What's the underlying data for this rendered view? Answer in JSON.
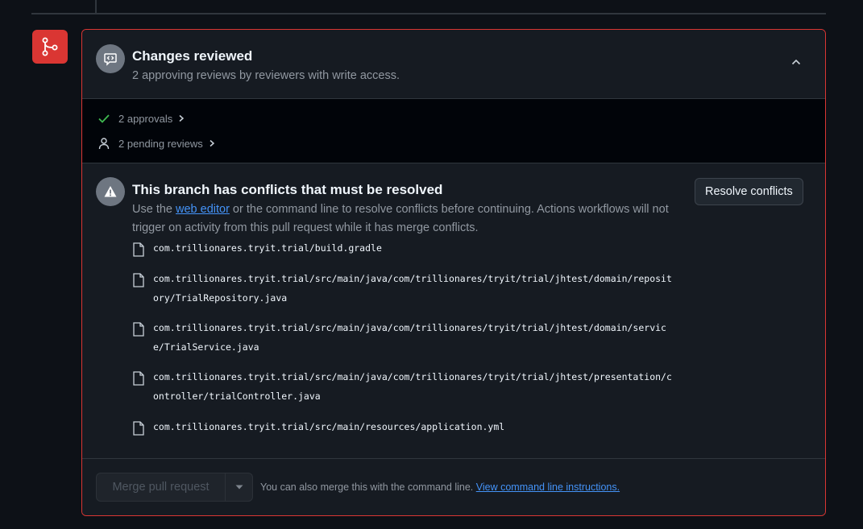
{
  "review": {
    "title": "Changes reviewed",
    "subtitle": "2 approving reviews by reviewers with write access."
  },
  "checks": {
    "approvals": "2 approvals",
    "pending": "2 pending reviews"
  },
  "conflicts": {
    "title": "This branch has conflicts that must be resolved",
    "desc_prefix": "Use the ",
    "desc_link": "web editor",
    "desc_suffix": " or the command line to resolve conflicts before continuing. Actions workflows will not trigger on activity from this pull request while it has merge conflicts.",
    "resolve_button": "Resolve conflicts",
    "files": [
      "com.trillionares.tryit.trial/build.gradle",
      "com.trillionares.tryit.trial/src/main/java/com/trillionares/tryit/trial/jhtest/domain/repository/TrialRepository.java",
      "com.trillionares.tryit.trial/src/main/java/com/trillionares/tryit/trial/jhtest/domain/service/TrialService.java",
      "com.trillionares.tryit.trial/src/main/java/com/trillionares/tryit/trial/jhtest/presentation/controller/trialController.java",
      "com.trillionares.tryit.trial/src/main/resources/application.yml"
    ]
  },
  "merge": {
    "button": "Merge pull request",
    "text_prefix": "You can also merge this with the command line. ",
    "text_link": "View command line instructions."
  },
  "colors": {
    "danger": "#da3633",
    "success": "#3fb950",
    "link": "#4493f8"
  }
}
